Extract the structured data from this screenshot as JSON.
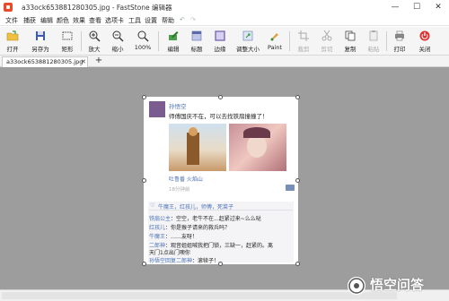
{
  "window": {
    "title": "a33ock653881280305.jpg - FastStone 编辑器",
    "minimize": "—",
    "maximize": "☐",
    "close": "✕"
  },
  "menu": [
    "文件",
    "捕获",
    "编辑",
    "颜色",
    "效果",
    "查看",
    "选项卡",
    "工具",
    "设置",
    "帮助"
  ],
  "toolbar": {
    "open": "打开",
    "save_as": "另存为",
    "rect": "矩形",
    "zoom_in": "放大",
    "zoom_out": "缩小",
    "zoom": "100%",
    "edit": "编辑",
    "caption": "标题",
    "border": "边缘",
    "resize": "调整大小",
    "paint": "Paint",
    "crop": "裁剪",
    "cut": "剪切",
    "copy": "复制",
    "paste": "粘贴",
    "print": "打印",
    "close": "关闭"
  },
  "tabs": {
    "file": "a33ock653881280305.jpg",
    "close": "✕",
    "add": "+"
  },
  "post": {
    "username": "孙悟空",
    "text": "师傅国庆不在，可以去找铁扇撞撞了！",
    "location": "吐鲁番 火焰山",
    "time": "18分钟前",
    "likes": "牛魔王，红孩儿，师傅，死菜子",
    "comments": [
      {
        "name": "铁扇公主",
        "text": "：空空，老牛不在...赶紧过来~么么哒"
      },
      {
        "name": "红孩儿",
        "text": "：你是猴子请来的救兵吗？"
      },
      {
        "name": "牛魔王",
        "text": "：……友呀！"
      },
      {
        "name": "二郎神",
        "text": "：观音姐姐喊我把门锁，三缺一，赶紧的。离"
      },
      {
        "name": "",
        "text": "天门1点出门噢你"
      },
      {
        "name": "孙悟空回复二郎神",
        "text": "：滚犊子！"
      }
    ]
  },
  "watermark": {
    "text": "悟空问答"
  },
  "colors": {
    "canvas": "#9d9d9d",
    "link": "#4a72b8",
    "toolbar": "#f5f5f5"
  }
}
